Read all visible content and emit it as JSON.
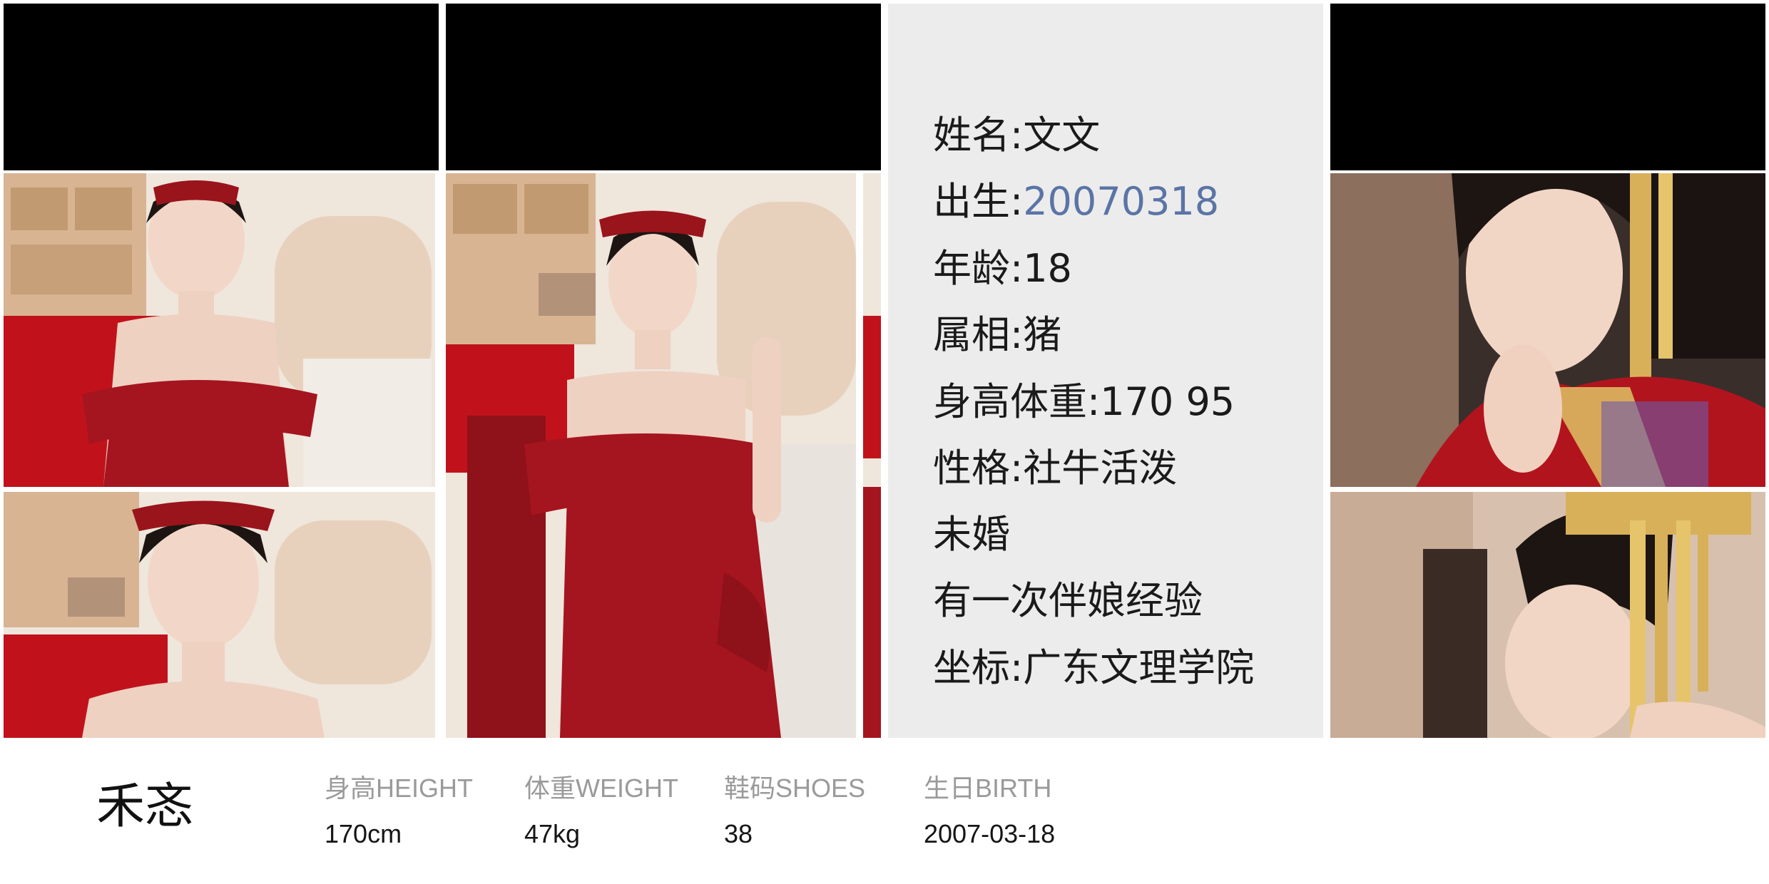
{
  "info": {
    "lines": [
      {
        "label": "姓名:",
        "value": "文文"
      },
      {
        "label": "出生:",
        "value": "20070318"
      },
      {
        "label": "年龄:",
        "value": "18"
      },
      {
        "label": "属相:",
        "value": "猪"
      },
      {
        "label": "身高体重:",
        "value": "170 95"
      },
      {
        "label": "性格:",
        "value": "社牛活泼"
      },
      {
        "label": "",
        "value": "未婚"
      },
      {
        "label": "",
        "value": "有一次伴娘经验"
      },
      {
        "label": "坐标:",
        "value": "广东文理学院"
      }
    ],
    "link_color": "#5b74a6"
  },
  "footer": {
    "name": "禾忞",
    "stats": [
      {
        "label": "身高HEIGHT",
        "value": "170cm"
      },
      {
        "label": "体重WEIGHT",
        "value": "47kg"
      },
      {
        "label": "鞋码SHOES",
        "value": "38"
      },
      {
        "label": "生日BIRTH",
        "value": "2007-03-18"
      }
    ]
  },
  "colors": {
    "panel_bg": "#ececec",
    "dress_red": "#a5151f",
    "backdrop_red": "#c1121c",
    "shelf_wood": "#d8b493"
  }
}
